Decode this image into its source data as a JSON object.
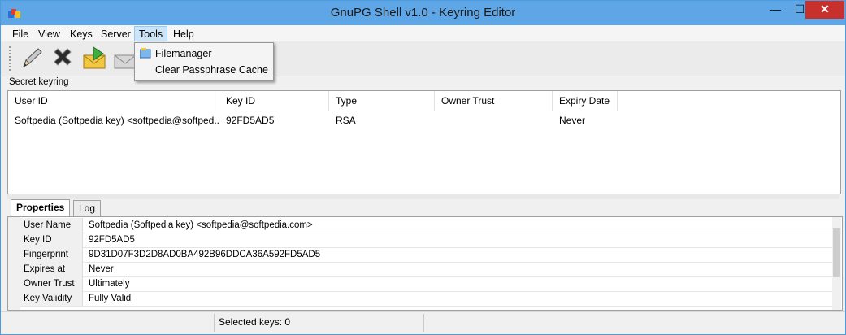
{
  "window": {
    "title": "GnuPG Shell v1.0 - Keyring Editor",
    "min_glyph": "—",
    "max_glyph": "☐",
    "close_glyph": "✕"
  },
  "menubar": {
    "items": [
      "File",
      "View",
      "Keys",
      "Server",
      "Tools",
      "Help"
    ],
    "open": "Tools"
  },
  "toolbar": {
    "icons": [
      "pencil-icon",
      "delete-x-icon",
      "envelope-export-icon",
      "envelope-import-icon"
    ]
  },
  "tools_menu": {
    "items": [
      {
        "label": "Filemanager",
        "icon": "filemanager-icon"
      },
      {
        "label": "Clear Passphrase Cache"
      }
    ]
  },
  "keyring": {
    "label": "Secret keyring",
    "columns": [
      "User ID",
      "Key ID",
      "Type",
      "Owner Trust",
      "Expiry Date"
    ],
    "rows": [
      [
        "Softpedia (Softpedia key) <softpedia@softped...",
        "92FD5AD5",
        "RSA",
        "",
        "Never"
      ]
    ]
  },
  "tabs": [
    "Properties",
    "Log"
  ],
  "properties": [
    {
      "key": "User Name",
      "value": "Softpedia (Softpedia key) <softpedia@softpedia.com>"
    },
    {
      "key": "Key ID",
      "value": "92FD5AD5"
    },
    {
      "key": "Fingerprint",
      "value": "9D31D07F3D2D8AD0BA492B96DDCA36A592FD5AD5"
    },
    {
      "key": "Expires at",
      "value": "Never"
    },
    {
      "key": "Owner Trust",
      "value": "Ultimately"
    },
    {
      "key": "Key Validity",
      "value": "Fully Valid"
    }
  ],
  "status": {
    "selected": "Selected keys: 0"
  },
  "colors": {
    "titlebar": "#5fa6e6",
    "close_button": "#c7302b",
    "menu_highlight": "#cce4f7"
  }
}
